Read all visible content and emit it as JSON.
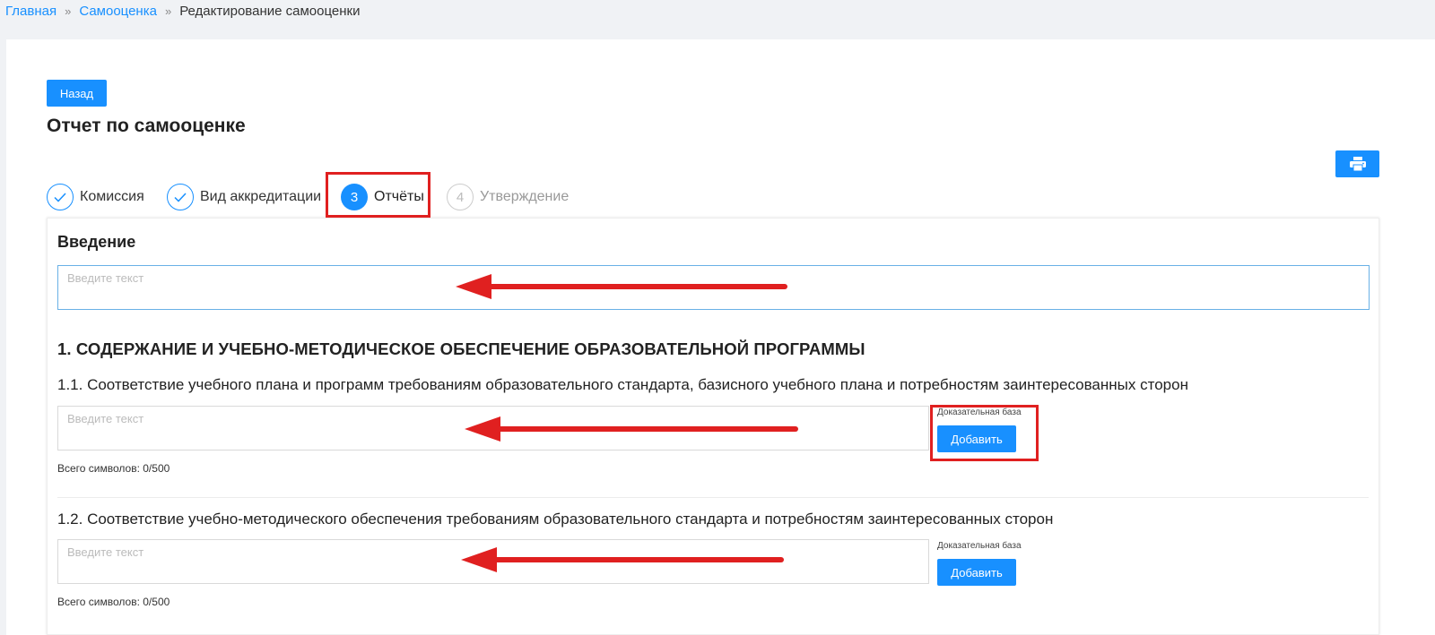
{
  "breadcrumb": {
    "home": "Главная",
    "selfassessment": "Самооценка",
    "separator": "»",
    "current": "Редактирование самооценки"
  },
  "toolbar": {
    "back_label": "Назад",
    "print_icon": "printer-icon"
  },
  "page_title": "Отчет по самооценке",
  "steps": [
    {
      "number": "1",
      "label": "Комиссия",
      "status": "done"
    },
    {
      "number": "2",
      "label": "Вид аккредитации",
      "status": "done"
    },
    {
      "number": "3",
      "label": "Отчёты",
      "status": "active"
    },
    {
      "number": "4",
      "label": "Утверждение",
      "status": "wait"
    }
  ],
  "intro": {
    "title": "Введение",
    "placeholder": "Введите текст"
  },
  "section": {
    "title": "1. СОДЕРЖАНИЕ И УЧЕБНО-МЕТОДИЧЕСКОЕ ОБЕСПЕЧЕНИЕ ОБРАЗОВАТЕЛЬНОЙ ПРОГРАММЫ",
    "items": [
      {
        "title": "1.1. Соответствие учебного плана и программ требованиям образовательного стандарта, базисного учебного плана и потребностям заинтересованных сторон",
        "placeholder": "Введите текст",
        "evidence_label": "Доказательная база",
        "add_label": "Добавить",
        "counter": "Всего символов: 0/500"
      },
      {
        "title": "1.2. Соответствие учебно-методического обеспечения требованиям образовательного стандарта и потребностям заинтересованных сторон",
        "placeholder": "Введите текст",
        "evidence_label": "Доказательная база",
        "add_label": "Добавить",
        "counter": "Всего символов: 0/500"
      }
    ]
  },
  "colors": {
    "primary": "#1890ff",
    "annotation": "#e02020"
  }
}
